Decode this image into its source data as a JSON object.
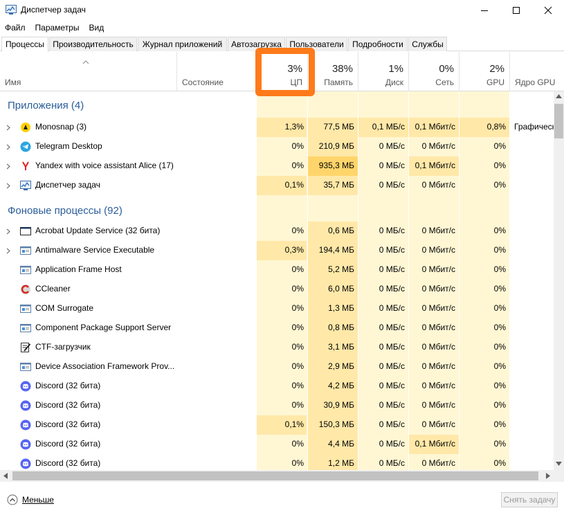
{
  "window": {
    "title": "Диспетчер задач",
    "minimize": "minimize",
    "maximize": "maximize",
    "close": "close"
  },
  "menu": [
    "Файл",
    "Параметры",
    "Вид"
  ],
  "tabs": [
    {
      "label": "Процессы",
      "active": true
    },
    {
      "label": "Производительность"
    },
    {
      "label": "Журнал приложений"
    },
    {
      "label": "Автозагрузка"
    },
    {
      "label": "Пользователи"
    },
    {
      "label": "Подробности"
    },
    {
      "label": "Службы"
    }
  ],
  "columns": {
    "name": "Имя",
    "status": "Состояние",
    "cpu": {
      "pct": "3%",
      "label": "ЦП"
    },
    "memory": {
      "pct": "38%",
      "label": "Память"
    },
    "disk": {
      "pct": "1%",
      "label": "Диск"
    },
    "network": {
      "pct": "0%",
      "label": "Сеть"
    },
    "gpu": {
      "pct": "2%",
      "label": "GPU"
    },
    "gpu_engine": "Ядро GPU"
  },
  "groups": {
    "apps": "Приложения (4)",
    "background": "Фоновые процессы (92)"
  },
  "apps": [
    {
      "name": "Monosnap (3)",
      "icon": "monosnap-icon",
      "expand": true,
      "cpu": "1,3%",
      "mem": "77,5 МБ",
      "disk": "0,1 МБ/с",
      "net": "0,1 Мбит/с",
      "gpu": "0,8%",
      "engine": "Графическ"
    },
    {
      "name": "Telegram Desktop",
      "icon": "telegram-icon",
      "expand": true,
      "cpu": "0%",
      "mem": "210,9 МБ",
      "disk": "0 МБ/с",
      "net": "0 Мбит/с",
      "gpu": "0%",
      "engine": ""
    },
    {
      "name": "Yandex with voice assistant Alice (17)",
      "icon": "yandex-icon",
      "expand": true,
      "cpu": "0%",
      "mem": "935,3 МБ",
      "disk": "0 МБ/с",
      "net": "0,1 Мбит/с",
      "gpu": "0%",
      "engine": ""
    },
    {
      "name": "Диспетчер задач",
      "icon": "task-manager-icon",
      "expand": true,
      "cpu": "0,1%",
      "mem": "35,7 МБ",
      "disk": "0 МБ/с",
      "net": "0 Мбит/с",
      "gpu": "0%",
      "engine": ""
    }
  ],
  "background": [
    {
      "name": "Acrobat Update Service (32 бита)",
      "icon": "window-icon",
      "expand": true,
      "cpu": "0%",
      "mem": "0,6 МБ",
      "disk": "0 МБ/с",
      "net": "0 Мбит/с",
      "gpu": "0%"
    },
    {
      "name": "Antimalware Service Executable",
      "icon": "service-icon",
      "expand": true,
      "cpu": "0,3%",
      "mem": "194,4 МБ",
      "disk": "0 МБ/с",
      "net": "0 Мбит/с",
      "gpu": "0%"
    },
    {
      "name": "Application Frame Host",
      "icon": "service-icon",
      "expand": false,
      "cpu": "0%",
      "mem": "5,2 МБ",
      "disk": "0 МБ/с",
      "net": "0 Мбит/с",
      "gpu": "0%"
    },
    {
      "name": "CCleaner",
      "icon": "ccleaner-icon",
      "expand": false,
      "cpu": "0%",
      "mem": "6,0 МБ",
      "disk": "0 МБ/с",
      "net": "0 Мбит/с",
      "gpu": "0%"
    },
    {
      "name": "COM Surrogate",
      "icon": "service-icon",
      "expand": false,
      "cpu": "0%",
      "mem": "1,3 МБ",
      "disk": "0 МБ/с",
      "net": "0 Мбит/с",
      "gpu": "0%"
    },
    {
      "name": "Component Package Support Server",
      "icon": "service-icon",
      "expand": false,
      "cpu": "0%",
      "mem": "0,8 МБ",
      "disk": "0 МБ/с",
      "net": "0 Мбит/с",
      "gpu": "0%"
    },
    {
      "name": "CTF-загрузчик",
      "icon": "ctf-icon",
      "expand": false,
      "cpu": "0%",
      "mem": "3,1 МБ",
      "disk": "0 МБ/с",
      "net": "0 Мбит/с",
      "gpu": "0%"
    },
    {
      "name": "Device Association Framework Prov...",
      "icon": "service-icon",
      "expand": false,
      "cpu": "0%",
      "mem": "2,9 МБ",
      "disk": "0 МБ/с",
      "net": "0 Мбит/с",
      "gpu": "0%"
    },
    {
      "name": "Discord (32 бита)",
      "icon": "discord-icon",
      "expand": false,
      "cpu": "0%",
      "mem": "4,2 МБ",
      "disk": "0 МБ/с",
      "net": "0 Мбит/с",
      "gpu": "0%"
    },
    {
      "name": "Discord (32 бита)",
      "icon": "discord-icon",
      "expand": false,
      "cpu": "0%",
      "mem": "30,9 МБ",
      "disk": "0 МБ/с",
      "net": "0 Мбит/с",
      "gpu": "0%"
    },
    {
      "name": "Discord (32 бита)",
      "icon": "discord-icon",
      "expand": false,
      "cpu": "0,1%",
      "mem": "150,3 МБ",
      "disk": "0 МБ/с",
      "net": "0 Мбит/с",
      "gpu": "0%"
    },
    {
      "name": "Discord (32 бита)",
      "icon": "discord-icon",
      "expand": false,
      "cpu": "0%",
      "mem": "4,4 МБ",
      "disk": "0 МБ/с",
      "net": "0,1 Мбит/с",
      "gpu": "0%"
    },
    {
      "name": "Discord (32 бита)",
      "icon": "discord-icon",
      "expand": false,
      "cpu": "0%",
      "mem": "1,2 МБ",
      "disk": "0 МБ/с",
      "net": "0 Мбит/с",
      "gpu": "0%"
    }
  ],
  "footer": {
    "less": "Меньше",
    "end_task": "Снять задачу"
  },
  "colors": {
    "heat_low": "#fff4c4",
    "heat_mid": "#ffe8a8",
    "heat_high": "#ffd56b",
    "highlight": "#ff7a1a",
    "group_title": "#2a5d9a"
  }
}
